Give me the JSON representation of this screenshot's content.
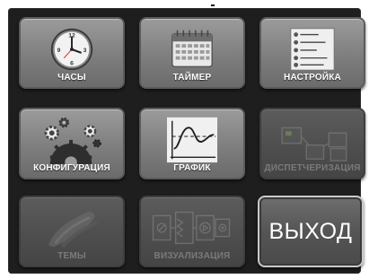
{
  "window": {
    "title_mark": "-"
  },
  "tiles": [
    {
      "label": "ЧАСЫ",
      "icon": "clock-icon",
      "enabled": true
    },
    {
      "label": "ТАЙМЕР",
      "icon": "calendar-icon",
      "enabled": true
    },
    {
      "label": "НАСТРОЙКА",
      "icon": "settings-checklist-icon",
      "enabled": true
    },
    {
      "label": "КОНФИГУРАЦИЯ",
      "icon": "gears-icon",
      "enabled": true
    },
    {
      "label": "ГРАФИК",
      "icon": "line-graph-icon",
      "enabled": true
    },
    {
      "label": "ДИСПЕТЧЕРИЗАЦИЯ",
      "icon": "network-boxes-icon",
      "enabled": false
    },
    {
      "label": "ТЕМЫ",
      "icon": "paint-brush-icon",
      "enabled": false
    },
    {
      "label": "ВИЗУАЛИЗАЦИЯ",
      "icon": "schematic-icon",
      "enabled": false
    }
  ],
  "exit": {
    "label": "ВЫХОД"
  },
  "colors": {
    "background": "#1e1e1e",
    "tile": "#8a8a8a",
    "tile_disabled": "#4d4d4d",
    "label": "#ffffff",
    "label_disabled": "#7a7a7a"
  }
}
